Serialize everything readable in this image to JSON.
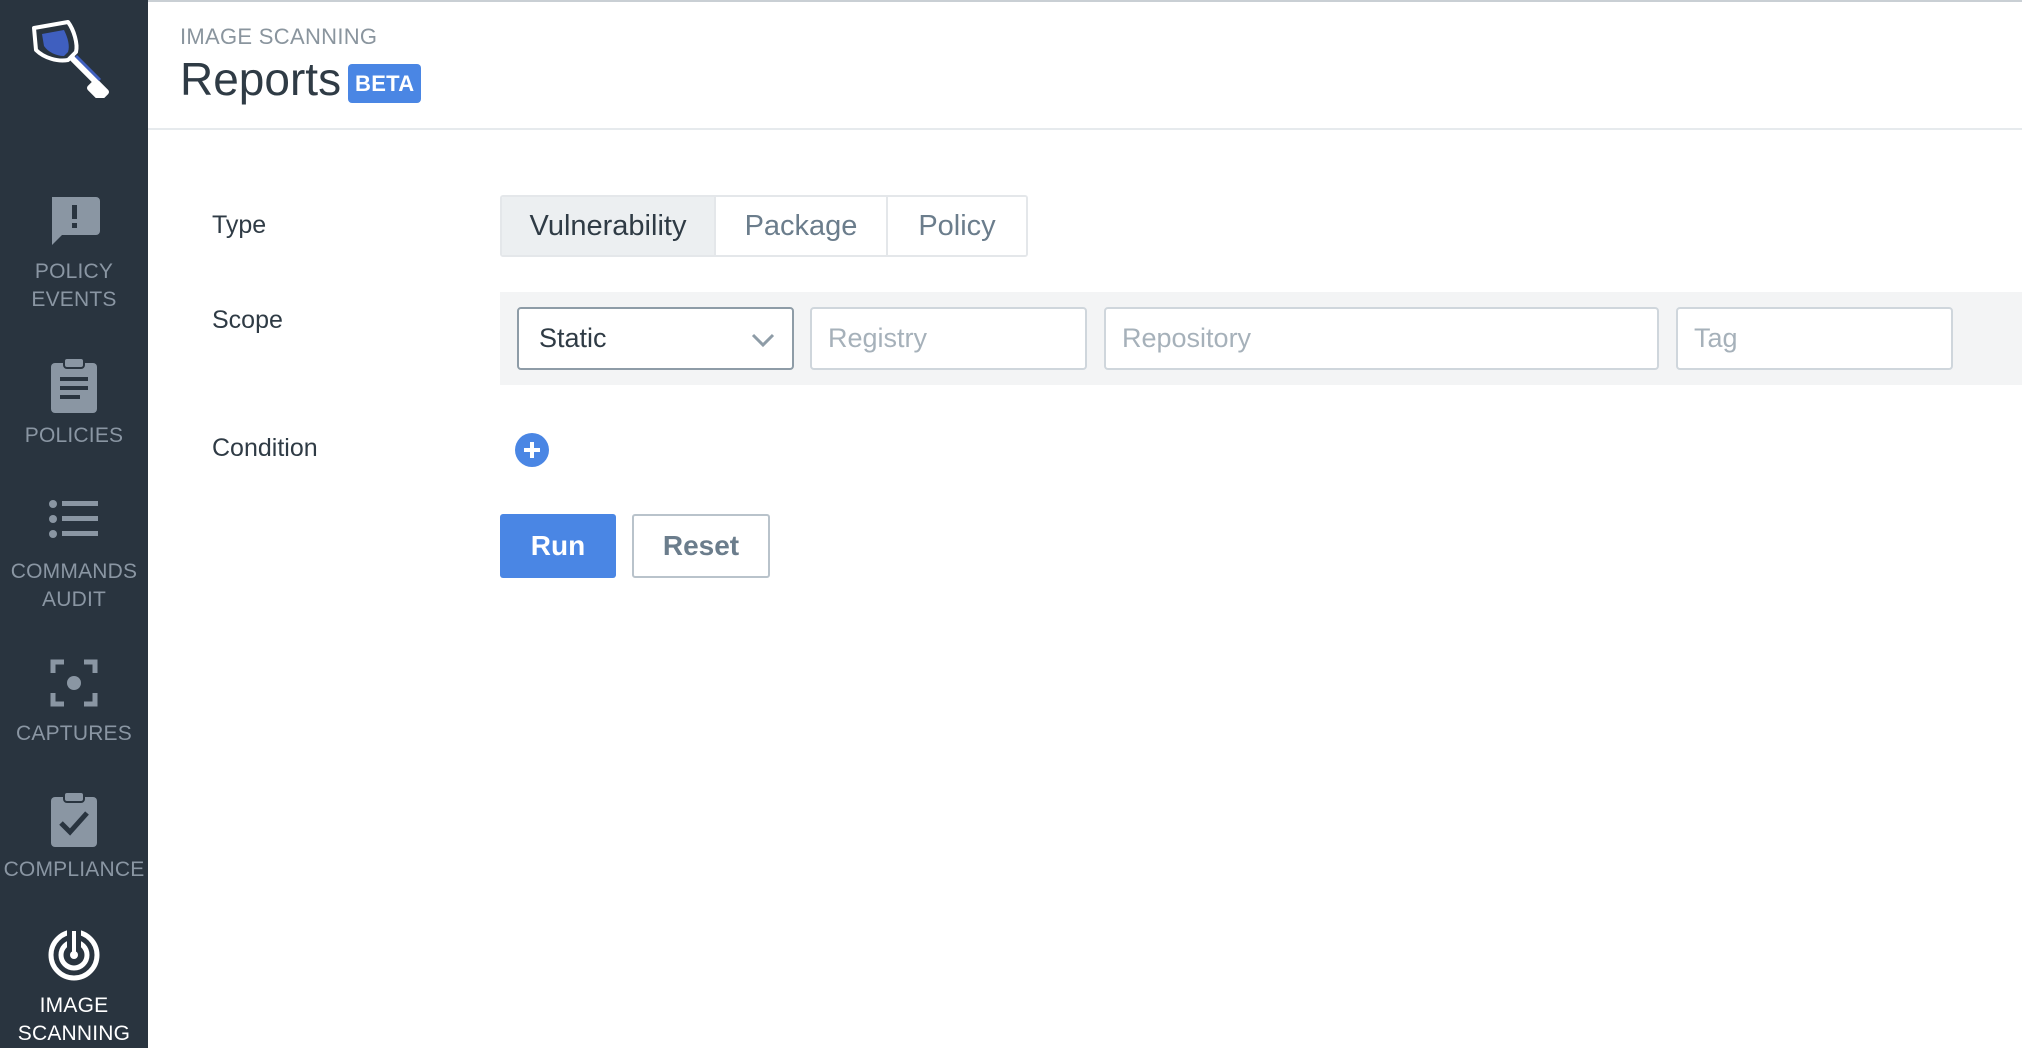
{
  "sidebar": {
    "logo": "shovel-logo",
    "items": [
      {
        "label": "POLICY\nEVENTS",
        "icon": "alert-message-icon",
        "active": false
      },
      {
        "label": "POLICIES",
        "icon": "clipboard-icon",
        "active": false
      },
      {
        "label": "COMMANDS\nAUDIT",
        "icon": "list-icon",
        "active": false
      },
      {
        "label": "CAPTURES",
        "icon": "capture-focus-icon",
        "active": false
      },
      {
        "label": "COMPLIANCE",
        "icon": "clipboard-check-icon",
        "active": false
      },
      {
        "label": "IMAGE\nSCANNING",
        "icon": "radar-icon",
        "active": true
      }
    ]
  },
  "header": {
    "breadcrumb": "IMAGE SCANNING",
    "title": "Reports",
    "badge": "BETA"
  },
  "form": {
    "type_label": "Type",
    "type_options": [
      "Vulnerability",
      "Package",
      "Policy"
    ],
    "type_selected": "Vulnerability",
    "scope_label": "Scope",
    "scope_select_value": "Static",
    "registry_placeholder": "Registry",
    "repository_placeholder": "Repository",
    "tag_placeholder": "Tag",
    "condition_label": "Condition",
    "run_label": "Run",
    "reset_label": "Reset"
  },
  "colors": {
    "sidebar_bg": "#29343f",
    "accent": "#4a86e4",
    "sidebar_icon": "#8a96a3"
  }
}
